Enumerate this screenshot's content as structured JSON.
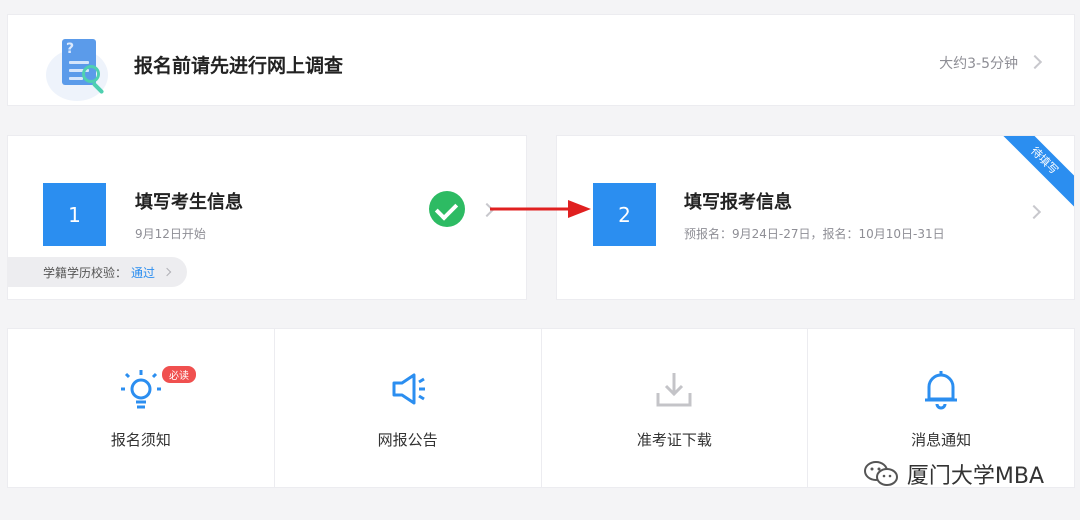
{
  "survey": {
    "title": "报名前请先进行网上调查",
    "duration": "大约3-5分钟",
    "illustration_mark": "?"
  },
  "step1": {
    "number": "1",
    "title": "填写考生信息",
    "subtitle": "9月12日开始",
    "verify_label": "学籍学历校验：",
    "verify_value": "通过"
  },
  "step2": {
    "number": "2",
    "title": "填写报考信息",
    "subtitle": "预报名：9月24日-27日，报名：10月10日-31日",
    "ribbon": "待填写"
  },
  "grid": {
    "items": [
      {
        "label": "报名须知",
        "badge": "必读",
        "icon": "lightbulb-icon"
      },
      {
        "label": "网报公告",
        "icon": "megaphone-icon"
      },
      {
        "label": "准考证下载",
        "icon": "download-icon"
      },
      {
        "label": "消息通知",
        "icon": "bell-icon"
      }
    ]
  },
  "watermark": "厦门大学MBA",
  "colors": {
    "accent": "#2b8ef0",
    "success": "#2dbb63",
    "badge": "#f0504f",
    "arrow": "#e02020"
  }
}
